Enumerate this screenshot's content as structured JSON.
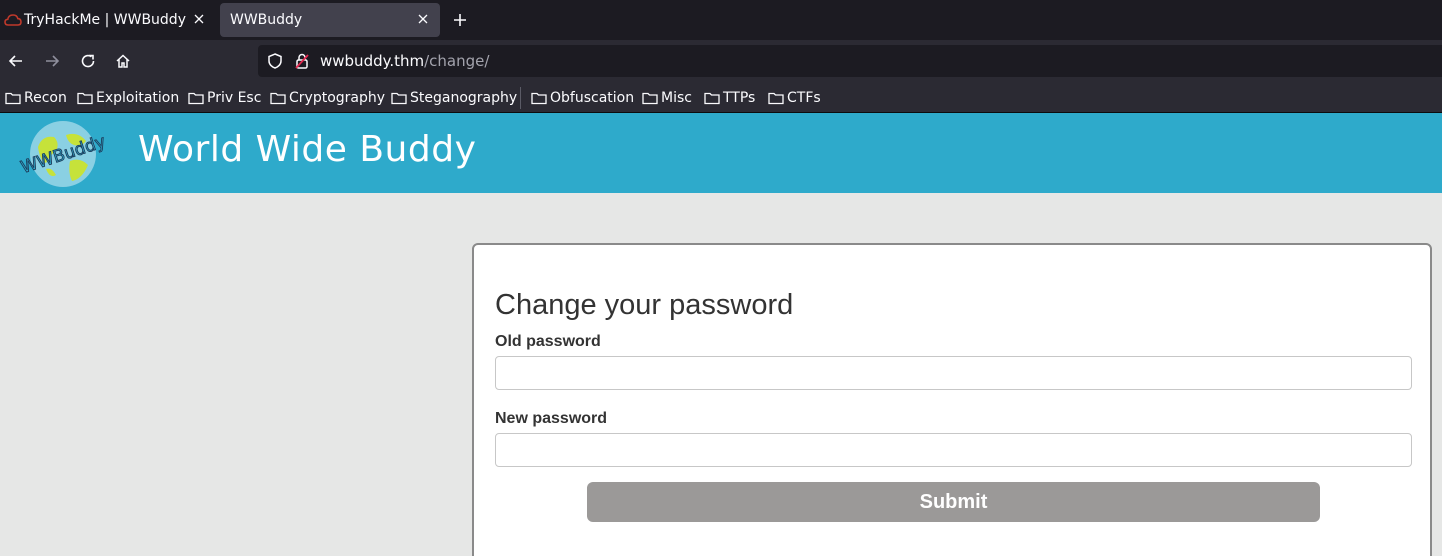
{
  "tabs": [
    {
      "title": "TryHackMe | WWBuddy",
      "active": false
    },
    {
      "title": "WWBuddy",
      "active": true
    }
  ],
  "url": {
    "host": "wwbuddy.thm",
    "path": "/change/"
  },
  "bookmarks": [
    "Recon",
    "Exploitation",
    "Priv Esc",
    "Cryptography",
    "Steganography",
    "Obfuscation",
    "Misc",
    "TTPs",
    "CTFs"
  ],
  "site": {
    "title": "World Wide Buddy",
    "logo_text": "WWBuddy"
  },
  "form": {
    "heading": "Change your password",
    "old_label": "Old password",
    "old_value": "",
    "new_label": "New password",
    "new_value": "",
    "submit_label": "Submit"
  },
  "colors": {
    "header": "#2eaacb",
    "submit": "#9b9998",
    "page_bg": "#e6e7e6"
  }
}
